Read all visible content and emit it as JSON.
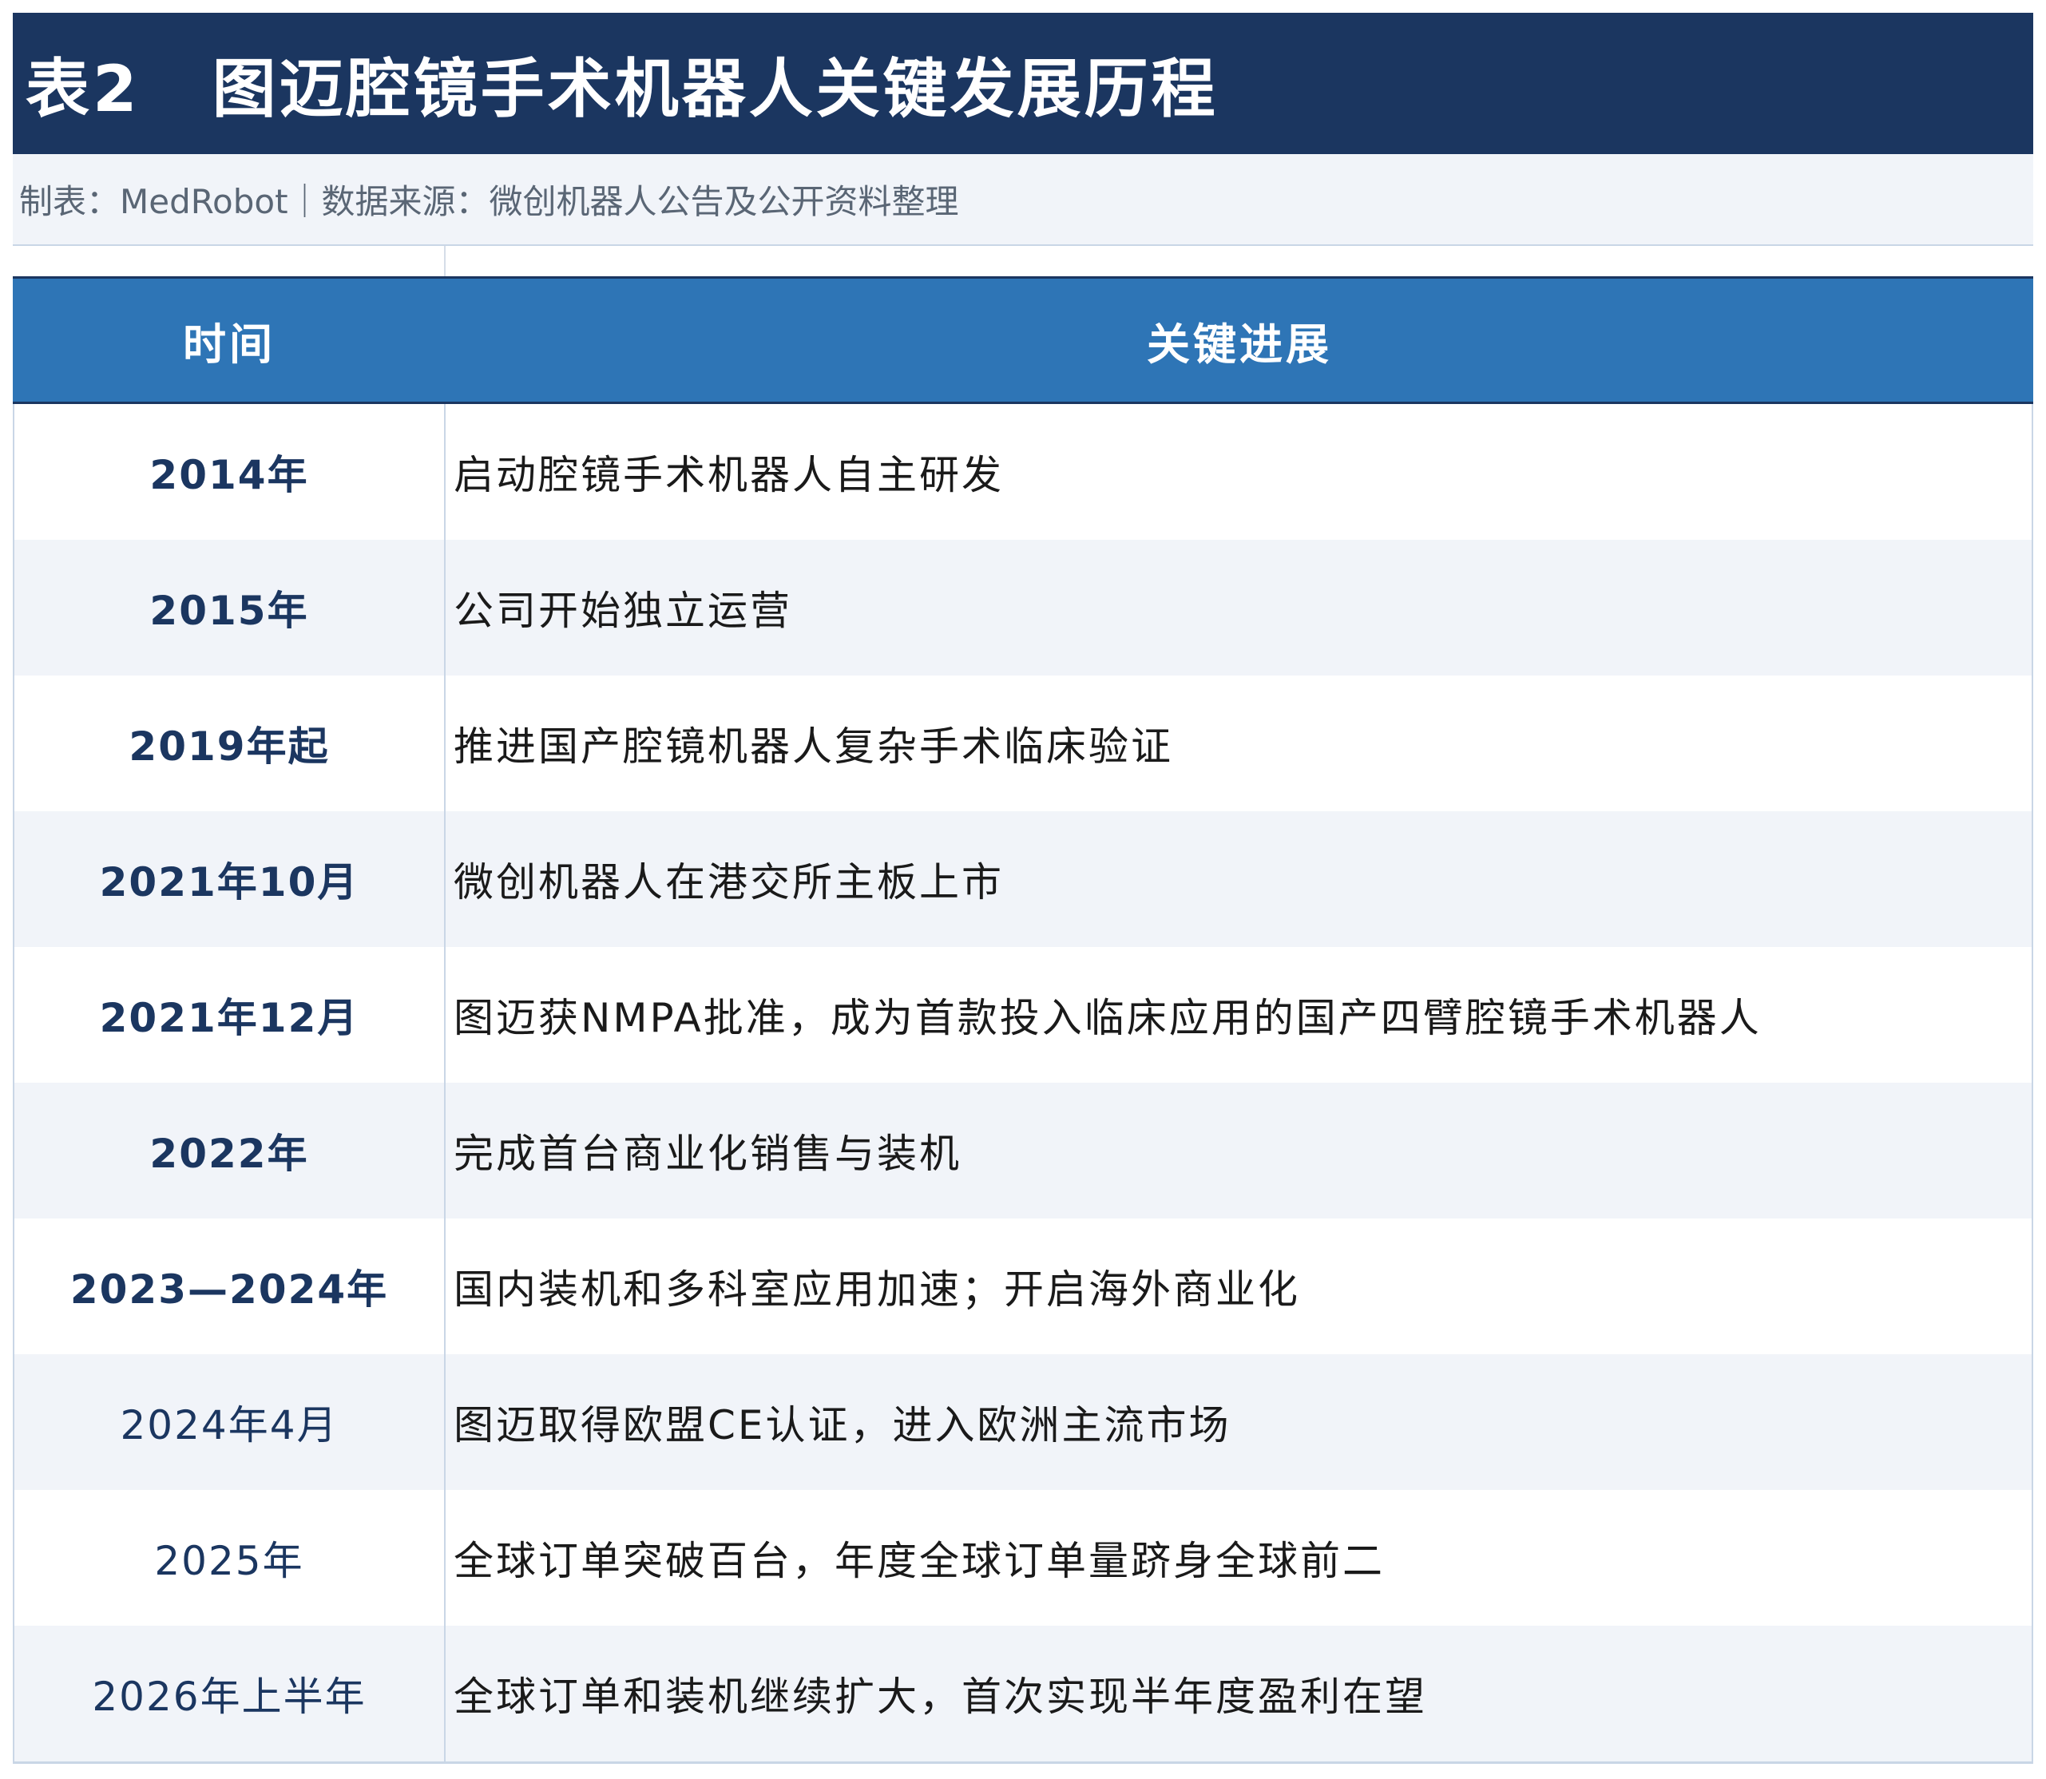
{
  "title": {
    "number": "表2",
    "text": "图迈腔镜手术机器人关键发展历程"
  },
  "source": "制表：MedRobot｜数据来源：微创机器人公告及公开资料整理",
  "table": {
    "headers": [
      "时间",
      "关键进展"
    ],
    "rows": [
      {
        "time": "2014年",
        "event": "启动腔镜手术机器人自主研发"
      },
      {
        "time": "2015年",
        "event": "公司开始独立运营"
      },
      {
        "time": "2019年起",
        "event": "推进国产腔镜机器人复杂手术临床验证"
      },
      {
        "time": "2021年10月",
        "event": "微创机器人在港交所主板上市"
      },
      {
        "time": "2021年12月",
        "event": "图迈获NMPA批准，成为首款投入临床应用的国产四臂腔镜手术机器人"
      },
      {
        "time": "2022年",
        "event": "完成首台商业化销售与装机"
      },
      {
        "time": "2023—2024年",
        "event": "国内装机和多科室应用加速；开启海外商业化"
      },
      {
        "time": "2024年4月",
        "event": "图迈取得欧盟CE认证，进入欧洲主流市场"
      },
      {
        "time": "2025年",
        "event": "全球订单突破百台，年度全球订单量跻身全球前二"
      },
      {
        "time": "2026年上半年",
        "event": "全球订单和装机继续扩大，首次实现半年度盈利在望"
      }
    ]
  }
}
